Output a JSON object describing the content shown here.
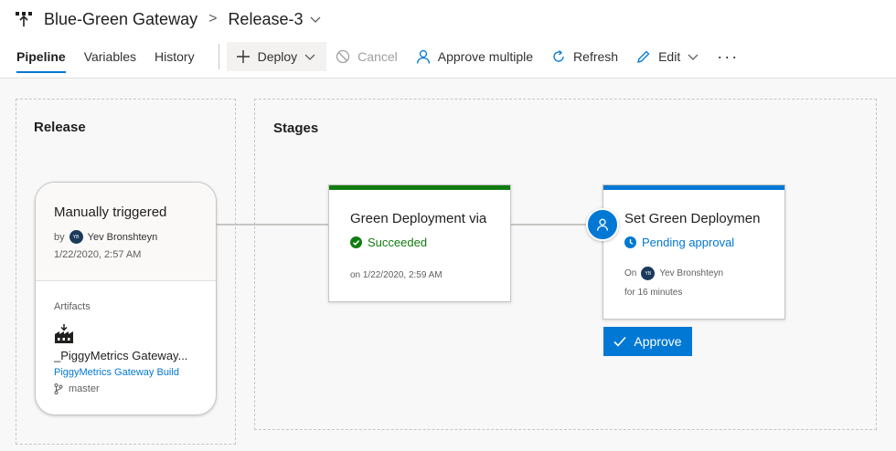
{
  "header": {
    "title": "Blue-Green Gateway",
    "breadcrumb_separator": ">",
    "release_name": "Release-3",
    "icons": {
      "app": "pipeline-release-icon",
      "release_dropdown": "chevron-down-icon"
    }
  },
  "tabs": [
    {
      "label": "Pipeline",
      "active": true
    },
    {
      "label": "Variables",
      "active": false
    },
    {
      "label": "History",
      "active": false
    }
  ],
  "toolbar": {
    "deploy": {
      "label": "Deploy",
      "icon": "plus-icon",
      "has_dropdown": true
    },
    "cancel": {
      "label": "Cancel",
      "icon": "cancel-circle-icon",
      "disabled": true
    },
    "approve_multiple": {
      "label": "Approve multiple",
      "icon": "person-icon"
    },
    "refresh": {
      "label": "Refresh",
      "icon": "refresh-icon"
    },
    "edit": {
      "label": "Edit",
      "icon": "pencil-icon",
      "has_dropdown": true
    },
    "more": "···"
  },
  "release_panel": {
    "title": "Release",
    "card": {
      "trigger": "Manually triggered",
      "by_prefix": "by",
      "avatar_initials": "YB",
      "by_name": "Yev Bronshteyn",
      "date": "1/22/2020, 2:57 AM",
      "artifacts_label": "Artifacts",
      "artifact_name": "_PiggyMetrics Gateway...",
      "artifact_build": "PiggyMetrics Gateway Build",
      "branch": "master"
    }
  },
  "stages_panel": {
    "title": "Stages",
    "stages": [
      {
        "name": "Green Deployment via",
        "status": "Succeeded",
        "status_icon": "check-circle-icon",
        "status_color": "#107c10",
        "bar_color": "#107c10",
        "meta": "on 1/22/2020, 2:59 AM"
      },
      {
        "name": "Set Green Deploymen",
        "status": "Pending approval",
        "status_icon": "clock-icon",
        "status_color": "#0078d4",
        "bar_color": "#0078d4",
        "meta_prefix": "On",
        "meta_avatar": "YB",
        "meta_name": "Yev Bronshteyn",
        "meta_duration": "for 16 minutes"
      }
    ],
    "approve_button": "Approve"
  },
  "colors": {
    "accent": "#0078d4",
    "success": "#107c10",
    "canvas_bg": "#f8f8f8"
  }
}
